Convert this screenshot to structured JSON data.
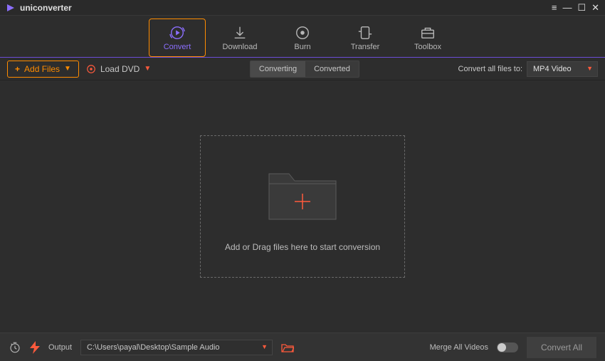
{
  "app": {
    "title": "uniconverter"
  },
  "nav": {
    "items": [
      {
        "label": "Convert"
      },
      {
        "label": "Download"
      },
      {
        "label": "Burn"
      },
      {
        "label": "Transfer"
      },
      {
        "label": "Toolbox"
      }
    ],
    "active_index": 0
  },
  "toolbar": {
    "add_files_label": "Add Files",
    "load_dvd_label": "Load DVD",
    "seg_tabs": {
      "converting": "Converting",
      "converted": "Converted",
      "active": "converting"
    },
    "convert_all_label": "Convert all files to:",
    "format_value": "MP4 Video"
  },
  "dropzone": {
    "hint": "Add or Drag files here to start conversion"
  },
  "footer": {
    "output_label": "Output",
    "output_path": "C:\\Users\\payal\\Desktop\\Sample Audio",
    "merge_label": "Merge All Videos",
    "merge_on": false,
    "convert_all_btn": "Convert All"
  }
}
